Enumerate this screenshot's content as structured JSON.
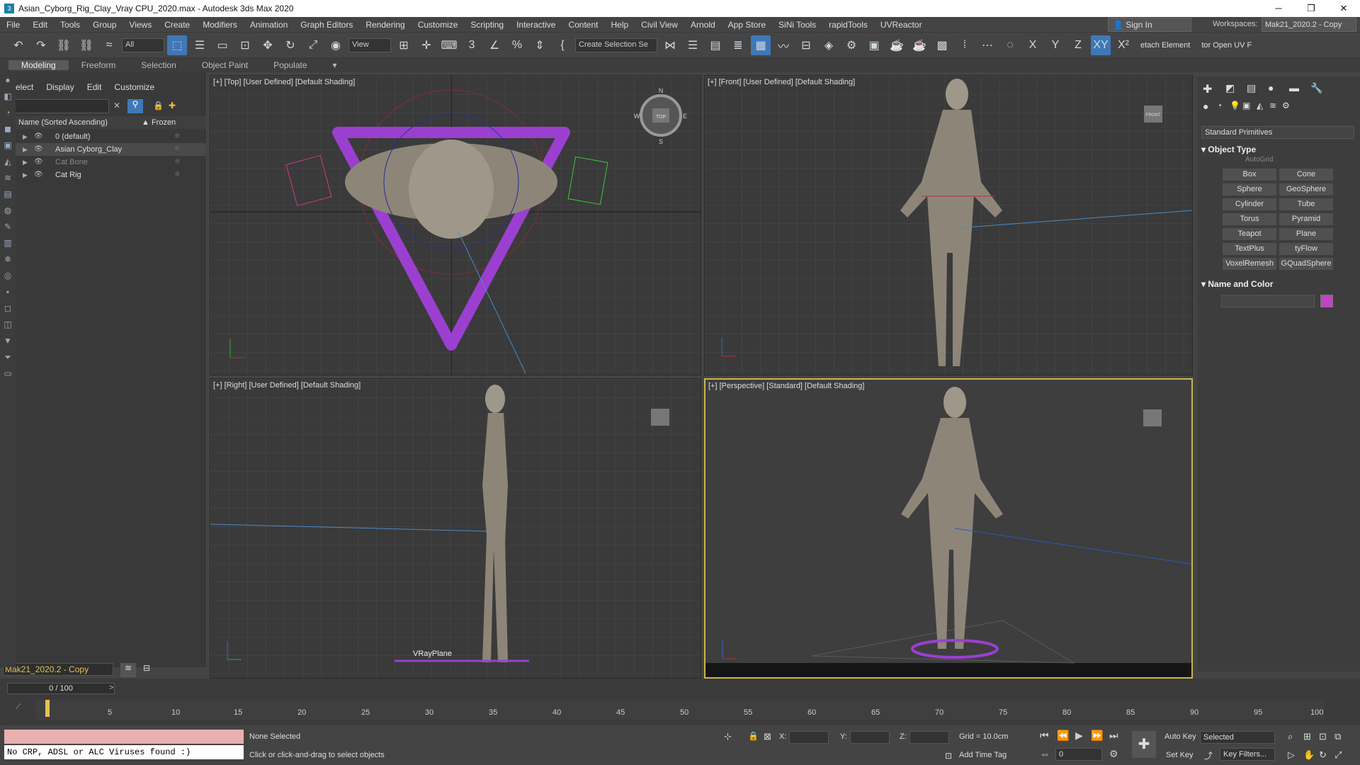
{
  "window": {
    "title": "Asian_Cyborg_Rig_Clay_Vray CPU_2020.max - Autodesk 3ds Max 2020",
    "app_icon": "3",
    "minimize": "─",
    "maximize": "❐",
    "close": "✕"
  },
  "menu": [
    "File",
    "Edit",
    "Tools",
    "Group",
    "Views",
    "Create",
    "Modifiers",
    "Animation",
    "Graph Editors",
    "Rendering",
    "Customize",
    "Scripting",
    "Interactive",
    "Content",
    "Help",
    "Civil View",
    "Arnold",
    "App Store",
    "SiNi Tools",
    "rapidTools",
    "UVReactor"
  ],
  "signin": {
    "label": "Sign In"
  },
  "workspace": {
    "label": "Workspaces:",
    "value": "Mak21_2020.2 - Copy"
  },
  "toolbar": {
    "filter": "All",
    "refcoord": "View",
    "selset": "Create Selection Se",
    "x": "X",
    "y": "Y",
    "z": "Z",
    "xy": "XY",
    "xpl": "X²",
    "detach": "etach Element",
    "openuv": "tor Open UV F"
  },
  "ribbon": [
    "Modeling",
    "Freeform",
    "Selection",
    "Object Paint",
    "Populate"
  ],
  "scene": {
    "menu": [
      "Select",
      "Display",
      "Edit",
      "Customize"
    ],
    "col_name": "Name (Sorted Ascending)",
    "col_frozen": "▲ Frozen",
    "rows": [
      {
        "name": "0 (default)"
      },
      {
        "name": "Asian Cyborg_Clay"
      },
      {
        "name": "Cat Bone"
      },
      {
        "name": "Cat Rig"
      }
    ],
    "layer": "Mak21_2020.2 - Copy"
  },
  "viewports": {
    "top": "[+] [Top] [User Defined] [Default Shading]",
    "front": "[+] [Front] [User Defined] [Default Shading]",
    "right": "[+] [Right] [User Defined] [Default Shading]",
    "persp": "[+] [Perspective] [Standard] [Default Shading]",
    "vrayplane": "VRayPlane",
    "cube_top": "TOP",
    "cube_front": "FRONT",
    "compass": {
      "n": "N",
      "s": "S",
      "e": "E",
      "w": "W"
    }
  },
  "cmd": {
    "dropdown": "Standard Primitives",
    "object_type": "Object Type",
    "autogrid": "AutoGrid",
    "buttons": [
      "Box",
      "Cone",
      "Sphere",
      "GeoSphere",
      "Cylinder",
      "Tube",
      "Torus",
      "Pyramid",
      "Teapot",
      "Plane",
      "TextPlus",
      "tyFlow",
      "VoxelRemesh",
      "GQuadSphere"
    ],
    "name_color": "Name and Color",
    "swatch_color": "#c442c4"
  },
  "timeline": {
    "frame": "0 / 100",
    "ticks": [
      "5",
      "10",
      "15",
      "20",
      "25",
      "30",
      "35",
      "40",
      "45",
      "50",
      "55",
      "60",
      "65",
      "70",
      "75",
      "80",
      "85",
      "90",
      "95",
      "100"
    ]
  },
  "status": {
    "maxscript": "No CRP, ADSL or ALC Viruses found :)",
    "selected": "None Selected",
    "prompt": "Click or click-and-drag to select objects",
    "x_label": "X:",
    "y_label": "Y:",
    "z_label": "Z:",
    "grid": "Grid = 10.0cm",
    "add_time_tag": "Add Time Tag",
    "auto_key": "Auto Key",
    "set_key": "Set Key",
    "key_sel": "Selected",
    "key_filters": "Key Filters...",
    "frame_num": "0"
  }
}
